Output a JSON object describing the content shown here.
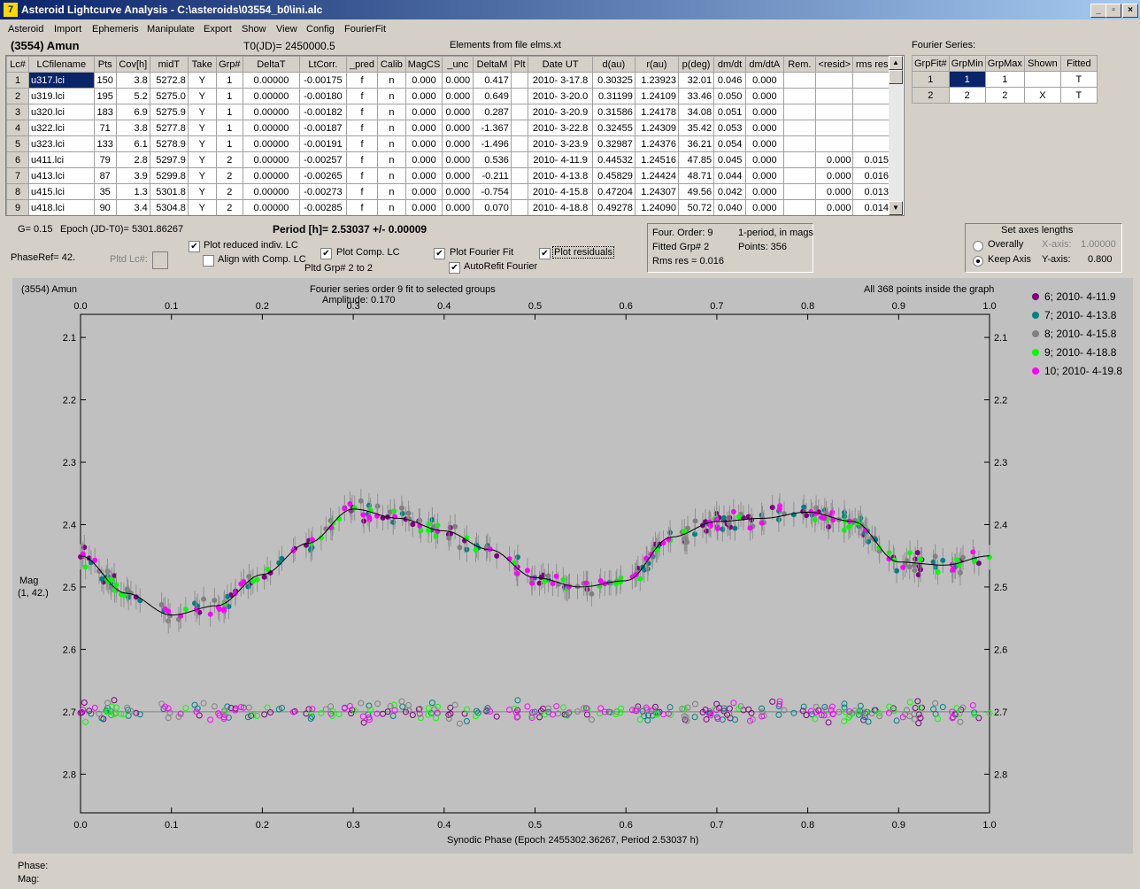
{
  "window": {
    "title": "Asteroid Lightcurve Analysis - C:\\asteroids\\03554_b0\\ini.alc",
    "icon": "app-icon",
    "btn_min": "_",
    "btn_max": "▫",
    "btn_close": "×"
  },
  "menu": [
    "Asteroid",
    "Import",
    "Ephemeris",
    "Manipulate",
    "Export",
    "Show",
    "View",
    "Config",
    "FourierFit"
  ],
  "header": {
    "asteroid": "(3554) Amun",
    "t0": "T0(JD)= 2450000.5",
    "elements": "Elements from file elms.xt"
  },
  "lc_table": {
    "columns": [
      "Lc#",
      "LCfilename",
      "Pts",
      "Cov[h]",
      "midT",
      "Take",
      "Grp#",
      "DeltaT",
      "LtCorr.",
      "_pred",
      "Calib",
      "MagCS",
      "_unc",
      "DeltaM",
      "Plt",
      "Date UT",
      "d(au)",
      "r(au)",
      "p(deg)",
      "dm/dt",
      "dm/dtA",
      "Rem.",
      "<resid>",
      "rms res"
    ],
    "rows": [
      [
        "1",
        "u317.lci",
        "150",
        "3.8",
        "5272.8",
        "Y",
        "1",
        "0.00000",
        "-0.00175",
        "f",
        "n",
        "0.000",
        "0.000",
        "0.417",
        "",
        "2010- 3-17.8",
        "0.30325",
        "1.23923",
        "32.01",
        "0.046",
        "0.000",
        "",
        "",
        ""
      ],
      [
        "2",
        "u319.lci",
        "195",
        "5.2",
        "5275.0",
        "Y",
        "1",
        "0.00000",
        "-0.00180",
        "f",
        "n",
        "0.000",
        "0.000",
        "0.649",
        "",
        "2010- 3-20.0",
        "0.31199",
        "1.24109",
        "33.46",
        "0.050",
        "0.000",
        "",
        "",
        ""
      ],
      [
        "3",
        "u320.lci",
        "183",
        "6.9",
        "5275.9",
        "Y",
        "1",
        "0.00000",
        "-0.00182",
        "f",
        "n",
        "0.000",
        "0.000",
        "0.287",
        "",
        "2010- 3-20.9",
        "0.31586",
        "1.24178",
        "34.08",
        "0.051",
        "0.000",
        "",
        "",
        ""
      ],
      [
        "4",
        "u322.lci",
        "71",
        "3.8",
        "5277.8",
        "Y",
        "1",
        "0.00000",
        "-0.00187",
        "f",
        "n",
        "0.000",
        "0.000",
        "-1.367",
        "",
        "2010- 3-22.8",
        "0.32455",
        "1.24309",
        "35.42",
        "0.053",
        "0.000",
        "",
        "",
        ""
      ],
      [
        "5",
        "u323.lci",
        "133",
        "6.1",
        "5278.9",
        "Y",
        "1",
        "0.00000",
        "-0.00191",
        "f",
        "n",
        "0.000",
        "0.000",
        "-1.496",
        "",
        "2010- 3-23.9",
        "0.32987",
        "1.24376",
        "36.21",
        "0.054",
        "0.000",
        "",
        "",
        ""
      ],
      [
        "6",
        "u411.lci",
        "79",
        "2.8",
        "5297.9",
        "Y",
        "2",
        "0.00000",
        "-0.00257",
        "f",
        "n",
        "0.000",
        "0.000",
        "0.536",
        "",
        "2010- 4-11.9",
        "0.44532",
        "1.24516",
        "47.85",
        "0.045",
        "0.000",
        "",
        "0.000",
        "0.015"
      ],
      [
        "7",
        "u413.lci",
        "87",
        "3.9",
        "5299.8",
        "Y",
        "2",
        "0.00000",
        "-0.00265",
        "f",
        "n",
        "0.000",
        "0.000",
        "-0.211",
        "",
        "2010- 4-13.8",
        "0.45829",
        "1.24424",
        "48.71",
        "0.044",
        "0.000",
        "",
        "0.000",
        "0.016"
      ],
      [
        "8",
        "u415.lci",
        "35",
        "1.3",
        "5301.8",
        "Y",
        "2",
        "0.00000",
        "-0.00273",
        "f",
        "n",
        "0.000",
        "0.000",
        "-0.754",
        "",
        "2010- 4-15.8",
        "0.47204",
        "1.24307",
        "49.56",
        "0.042",
        "0.000",
        "",
        "0.000",
        "0.013"
      ],
      [
        "9",
        "u418.lci",
        "90",
        "3.4",
        "5304.8",
        "Y",
        "2",
        "0.00000",
        "-0.00285",
        "f",
        "n",
        "0.000",
        "0.000",
        "0.070",
        "",
        "2010- 4-18.8",
        "0.49278",
        "1.24090",
        "50.72",
        "0.040",
        "0.000",
        "",
        "0.000",
        "0.014"
      ]
    ]
  },
  "fourier_table": {
    "title": "Fourier Series:",
    "columns": [
      "GrpFit#",
      "GrpMin",
      "GrpMax",
      "Shown",
      "Fitted"
    ],
    "rows": [
      [
        "1",
        "1",
        "1",
        "",
        "T"
      ],
      [
        "2",
        "2",
        "2",
        "X",
        "T"
      ]
    ]
  },
  "controls": {
    "g": "G= 0.15",
    "epoch": "Epoch (JD-T0)= 5301.86267",
    "period": "Period [h]= 2.53037 +/- 0.00009",
    "phaseref": "PhaseRef= 42.",
    "pltd_lc": "Pltd Lc#:",
    "plot_reduced": "Plot reduced indiv. LC",
    "align_comp": "Align with Comp. LC",
    "plot_comp": "Plot Comp. LC",
    "pltd_grp": "Pltd Grp#  2  to  2",
    "plot_fourier": "Plot Fourier Fit",
    "autorefit": "AutoRefit Fourier",
    "plot_resid": "Plot residuals",
    "chk_plot_reduced": "✔",
    "chk_align_comp": "",
    "chk_plot_comp": "✔",
    "chk_plot_fourier": "✔",
    "chk_autorefit": "✔",
    "chk_plot_resid": "✔",
    "info_order": "Four. Order:  9",
    "info_period": "1-period, in mags",
    "info_fitted": "Fitted Grp# 2",
    "info_points": "Points: 356",
    "info_rms": "Rms res    = 0.016",
    "axes_title": "Set axes lengths",
    "radio_overally": "Overally",
    "radio_keep": "Keep Axis",
    "xaxis_label": "X-axis:",
    "xaxis_val": "1.00000",
    "yaxis_label": "Y-axis:",
    "yaxis_val": "0.800"
  },
  "plot": {
    "top_left": "(3554) Amun",
    "top_center1": "Fourier series order 9 fit to selected groups",
    "top_center2": "Amplitude: 0.170",
    "top_right": "All 368 points inside the graph",
    "ylabel1": "Mag",
    "ylabel2": "(1, 42.)",
    "xlabel": "Synodic Phase (Epoch 2455302.36267, Period 2.53037 h)",
    "status_phase": "Phase:",
    "status_mag": "Mag:"
  },
  "chart_data": {
    "type": "scatter",
    "title": "Fourier series order 9 fit to selected groups",
    "xlabel": "Synodic Phase (Epoch 2455302.36267, Period 2.53037 h)",
    "ylabel": "Mag",
    "xlim": [
      0.0,
      1.0
    ],
    "ylim": [
      2.8,
      2.0
    ],
    "ylim_visible": [
      2.063,
      2.862
    ],
    "x_ticks": [
      "0.0",
      "0.1",
      "0.2",
      "0.3",
      "0.4",
      "0.5",
      "0.6",
      "0.7",
      "0.8",
      "0.9",
      "1.0"
    ],
    "y_ticks": [
      "2.1",
      "2.2",
      "2.3",
      "2.4",
      "2.5",
      "2.6",
      "2.7",
      "2.8"
    ],
    "residual_baseline": 2.7,
    "fourier_fit": {
      "x": [
        0.0,
        0.05,
        0.1,
        0.15,
        0.2,
        0.25,
        0.3,
        0.35,
        0.4,
        0.45,
        0.5,
        0.55,
        0.6,
        0.65,
        0.7,
        0.75,
        0.8,
        0.85,
        0.9,
        0.95,
        1.0
      ],
      "y": [
        2.45,
        2.51,
        2.545,
        2.53,
        2.48,
        2.43,
        2.375,
        2.39,
        2.41,
        2.44,
        2.485,
        2.5,
        2.49,
        2.42,
        2.395,
        2.39,
        2.38,
        2.395,
        2.46,
        2.465,
        2.45
      ]
    },
    "series": [
      {
        "name": "6; 2010- 4-11.9",
        "color": "#800080"
      },
      {
        "name": "7; 2010- 4-13.8",
        "color": "#008080"
      },
      {
        "name": "8; 2010- 4-15.8",
        "color": "#808080"
      },
      {
        "name": "9; 2010- 4-18.8",
        "color": "#00ff00"
      },
      {
        "name": "10; 2010- 4-19.8",
        "color": "#ff00ff"
      }
    ],
    "grid": false,
    "legend_position": "right"
  }
}
